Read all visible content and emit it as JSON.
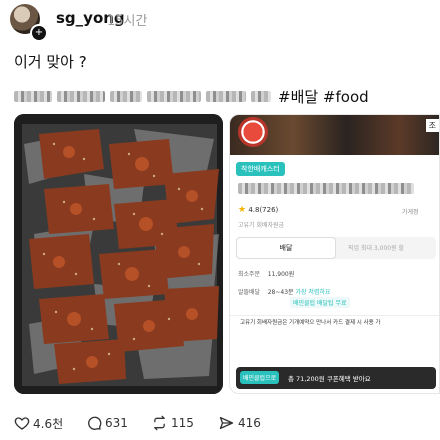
{
  "post": {
    "username": "sg_yong",
    "time": "15시간",
    "caption_line1": "이거 맞아 ?",
    "hashtags": "#배달 #food"
  },
  "app_screenshot": {
    "corner_label": "조",
    "badge": "착한배캐스터",
    "rating": "4.8(726)",
    "rating_right": "가게정",
    "subline": "고유기 회배자원금",
    "tab_delivery": "배달",
    "tab_pickup": "픽업",
    "tab_pickup_note": "최대 3,000원 할",
    "min_order_label": "최소주문",
    "min_order_value": "11,900원",
    "delivery_label": "알뜰배달",
    "delivery_time": "28~43분",
    "delivery_note": "가장 저렴하요",
    "chip_text": "배민클럽 배달팁 무료",
    "notice": "고유기 회배자원금은 기개예약으 만나서 카드 결제 시 사용 가",
    "cta_pill": "배민클럽으로",
    "cta_text": "총 71,200원 쿠폰혜택 받아요"
  },
  "actions": {
    "likes": "4.6천",
    "comments": "631",
    "reposts": "115",
    "shares": "416"
  },
  "icons": [
    "heart-icon",
    "comment-icon",
    "repost-icon",
    "share-icon",
    "follow-plus-icon"
  ],
  "colors": {
    "accent": "#2ac1bc",
    "text": "#111111",
    "muted": "#999999"
  }
}
